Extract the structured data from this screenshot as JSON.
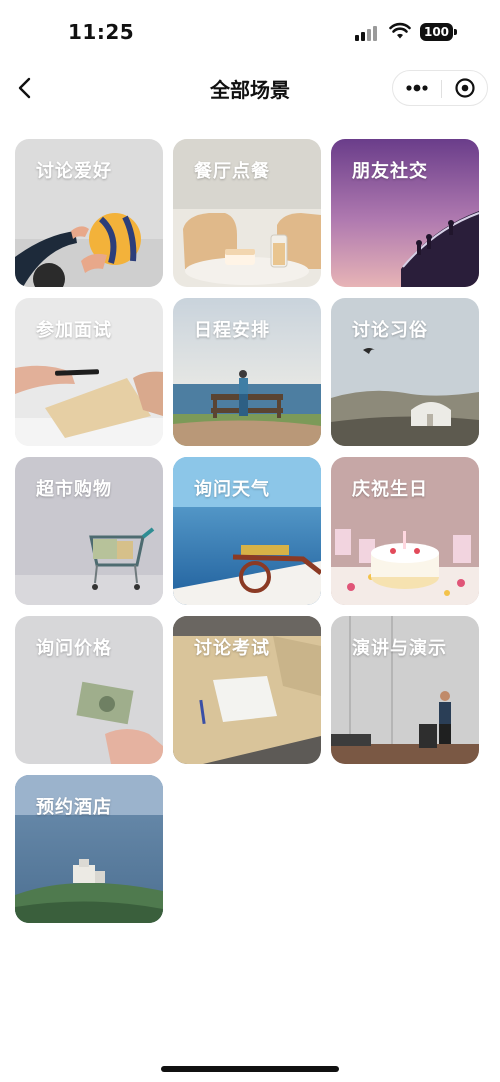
{
  "status_bar": {
    "time": "11:25",
    "battery": "100"
  },
  "nav": {
    "title": "全部场景"
  },
  "scenes": [
    {
      "label": "讨论爱好"
    },
    {
      "label": "餐厅点餐"
    },
    {
      "label": "朋友社交"
    },
    {
      "label": "参加面试"
    },
    {
      "label": "日程安排"
    },
    {
      "label": "讨论习俗"
    },
    {
      "label": "超市购物"
    },
    {
      "label": "询问天气"
    },
    {
      "label": "庆祝生日"
    },
    {
      "label": "询问价格"
    },
    {
      "label": "讨论考试"
    },
    {
      "label": "演讲与演示"
    },
    {
      "label": "预约酒店"
    }
  ],
  "icons": {
    "back": "chevron-left-icon",
    "more": "more-dots-icon",
    "close": "target-circle-icon"
  }
}
